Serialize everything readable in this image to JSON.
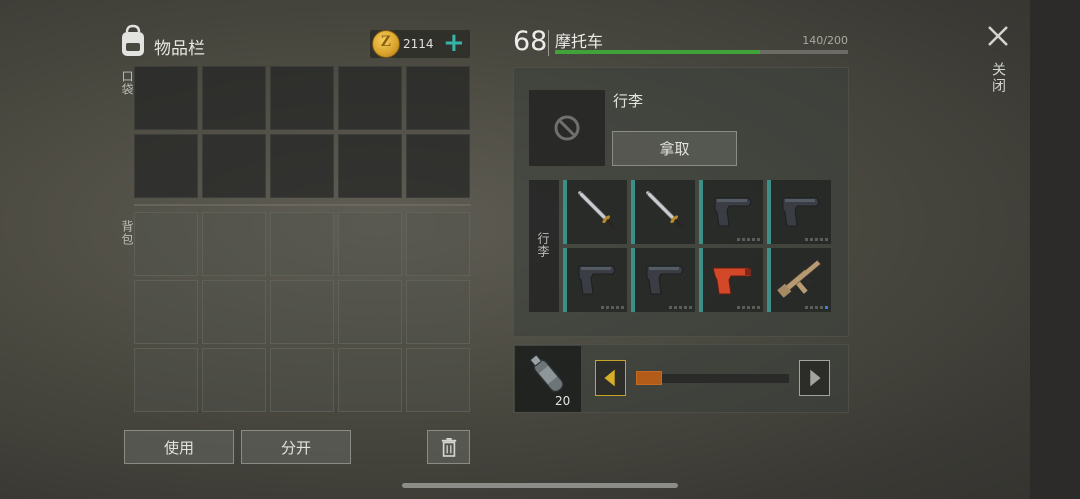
{
  "header": {
    "inventory_title": "物品栏",
    "coins": "2114",
    "coin_symbol": "Z",
    "add_icon": "plus-icon"
  },
  "inventory": {
    "pocket_label": "口袋",
    "backpack_label": "背包",
    "pocket_slots": 10,
    "backpack_slots": 15
  },
  "actions": {
    "use_label": "使用",
    "split_label": "分开",
    "trash_icon": "trash-icon"
  },
  "vehicle": {
    "level": "68",
    "name": "摩托车",
    "capacity_text": "140/200",
    "capacity_fraction": 0.7,
    "bar_color": "#3fa33a"
  },
  "trunk": {
    "slot_label": "行李",
    "take_label": "拿取",
    "items_label": "行李",
    "items": [
      {
        "name": "katana",
        "icon": "katana-icon",
        "durability": 0
      },
      {
        "name": "katana",
        "icon": "katana-icon",
        "durability": 0
      },
      {
        "name": "pistol",
        "icon": "pistol-icon",
        "durability": 0
      },
      {
        "name": "pistol",
        "icon": "pistol-icon",
        "durability": 0
      },
      {
        "name": "pistol",
        "icon": "pistol-icon",
        "durability": 0
      },
      {
        "name": "pistol",
        "icon": "pistol-icon",
        "durability": 0
      },
      {
        "name": "flare gun",
        "icon": "flare-gun-icon",
        "durability": 0
      },
      {
        "name": "assault rifle",
        "icon": "rifle-icon",
        "durability": 1
      }
    ]
  },
  "fuel": {
    "icon": "gas-canister-icon",
    "count": "20",
    "slider_fraction": 0.12,
    "accent": "#c66a22"
  },
  "close": {
    "label": "关闭"
  }
}
